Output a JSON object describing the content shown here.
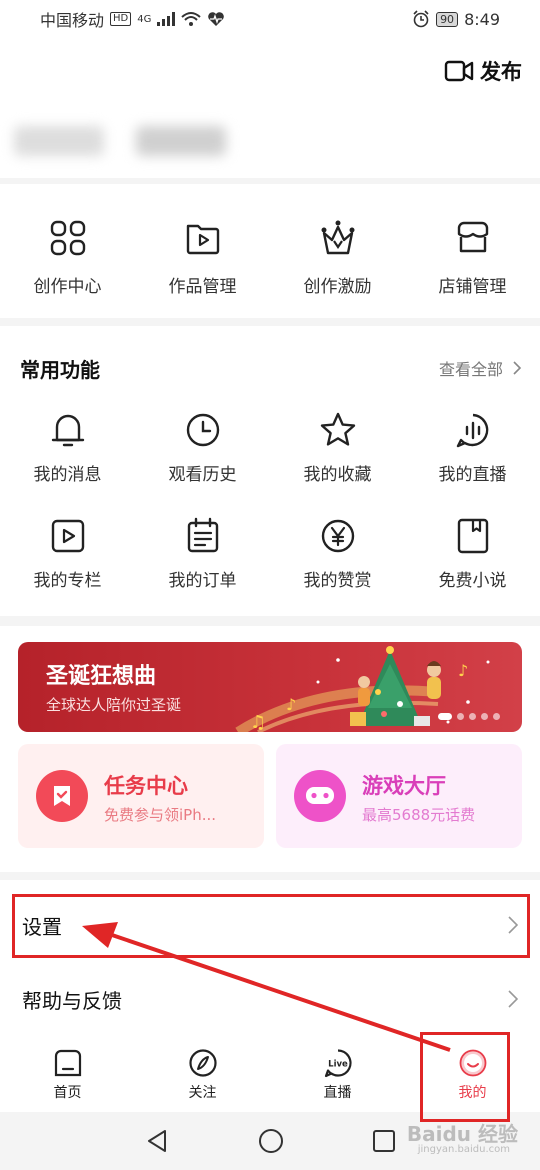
{
  "status_bar": {
    "carrier": "中国移动",
    "hd": "HD",
    "network": "4G",
    "battery": "90",
    "time": "8:49"
  },
  "header": {
    "publish_label": "发布"
  },
  "creator_tools": [
    {
      "label": "创作中心",
      "icon": "grid-icon"
    },
    {
      "label": "作品管理",
      "icon": "folder-play-icon"
    },
    {
      "label": "创作激励",
      "icon": "crown-basket-icon"
    },
    {
      "label": "店铺管理",
      "icon": "shop-icon"
    }
  ],
  "common_functions": {
    "title": "常用功能",
    "view_all": "查看全部",
    "items": [
      {
        "label": "我的消息",
        "icon": "bell-icon"
      },
      {
        "label": "观看历史",
        "icon": "clock-icon"
      },
      {
        "label": "我的收藏",
        "icon": "star-icon"
      },
      {
        "label": "我的直播",
        "icon": "live-audio-icon"
      },
      {
        "label": "我的专栏",
        "icon": "play-box-icon"
      },
      {
        "label": "我的订单",
        "icon": "order-list-icon"
      },
      {
        "label": "我的赞赏",
        "icon": "yen-icon"
      },
      {
        "label": "免费小说",
        "icon": "book-icon"
      }
    ]
  },
  "banner": {
    "title": "圣诞狂想曲",
    "subtitle": "全球达人陪你过圣诞"
  },
  "promos": {
    "task": {
      "title": "任务中心",
      "subtitle": "免费参与领iPh..."
    },
    "game": {
      "title": "游戏大厅",
      "subtitle": "最高5688元话费"
    }
  },
  "settings_list": [
    {
      "label": "设置"
    },
    {
      "label": "帮助与反馈"
    }
  ],
  "tabs": [
    {
      "label": "首页"
    },
    {
      "label": "关注"
    },
    {
      "label": "直播"
    },
    {
      "label": "我的"
    }
  ],
  "watermark": {
    "main": "Baidu 经验",
    "sub": "jingyan.baidu.com"
  },
  "colors": {
    "accent": "#e83c4a",
    "highlight": "#e02626",
    "banner": "#c8323a",
    "game": "#ee52c8"
  }
}
